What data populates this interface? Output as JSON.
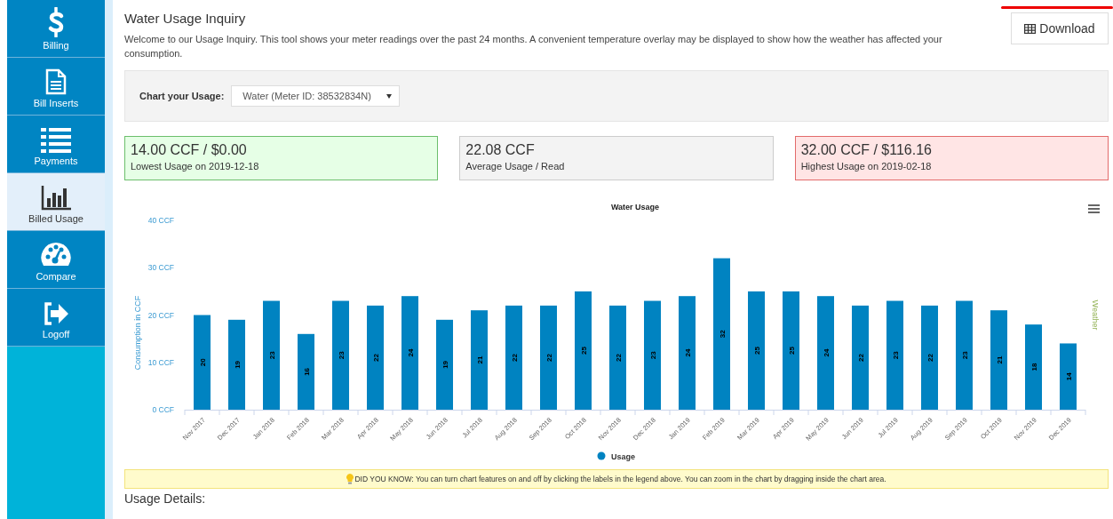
{
  "sidebar": {
    "items": [
      {
        "label": "Billing",
        "selected": false
      },
      {
        "label": "Bill Inserts",
        "selected": false
      },
      {
        "label": "Payments",
        "selected": false
      },
      {
        "label": "Billed Usage",
        "selected": true
      },
      {
        "label": "Compare",
        "selected": false
      },
      {
        "label": "Logoff",
        "selected": false
      }
    ]
  },
  "header": {
    "title": "Water Usage Inquiry",
    "intro": "Welcome to our Usage Inquiry. This tool shows your meter readings over the past 24 months. A convenient temperature overlay may be displayed to show how the weather has affected your consumption.",
    "download_button": "Download"
  },
  "filter": {
    "label": "Chart your Usage:",
    "meter_select": "Water (Meter ID: 38532834N)"
  },
  "stats": [
    {
      "kind": "lowest",
      "value": "14.00 CCF / $0.00",
      "caption": "Lowest Usage on 2019-12-18"
    },
    {
      "kind": "average",
      "value": "22.08 CCF",
      "caption": "Average Usage / Read"
    },
    {
      "kind": "highest",
      "value": "32.00 CCF / $116.16",
      "caption": "Highest Usage on 2019-02-18"
    }
  ],
  "chart": {
    "secondary_axis_title": "Weather",
    "chart_data": {
      "type": "bar",
      "title": "Water Usage",
      "ylabel": "Consumption in CCF",
      "categories": [
        "Nov 2017",
        "Dec 2017",
        "Jan 2018",
        "Feb 2018",
        "Mar 2018",
        "Apr 2018",
        "May 2018",
        "Jun 2018",
        "Jul 2018",
        "Aug 2018",
        "Sep 2018",
        "Oct 2018",
        "Nov 2018",
        "Dec 2018",
        "Jan 2019",
        "Feb 2019",
        "Mar 2019",
        "Apr 2019",
        "May 2019",
        "Jun 2019",
        "Jul 2019",
        "Aug 2019",
        "Sep 2019",
        "Oct 2019",
        "Nov 2019",
        "Dec 2019"
      ],
      "series": [
        {
          "name": "Usage",
          "color": "#0083c1",
          "values": [
            20,
            19,
            23,
            16,
            23,
            22,
            24,
            19,
            21,
            22,
            22,
            25,
            22,
            23,
            24,
            32,
            25,
            25,
            24,
            22,
            23,
            22,
            23,
            21,
            18,
            14
          ]
        }
      ],
      "ylim": [
        0,
        40
      ],
      "yticks": [
        {
          "value": 0,
          "label": "0 CCF"
        },
        {
          "value": 10,
          "label": "10 CCF"
        },
        {
          "value": 20,
          "label": "20 CCF"
        },
        {
          "value": 30,
          "label": "30 CCF"
        },
        {
          "value": 40,
          "label": "40 CCF"
        }
      ],
      "data_labels": true
    }
  },
  "tip": "DID YOU KNOW: You can turn chart features on and off by clicking the labels in the legend above. You can zoom in the chart by dragging inside the chart area.",
  "details_heading": "Usage Details:"
}
